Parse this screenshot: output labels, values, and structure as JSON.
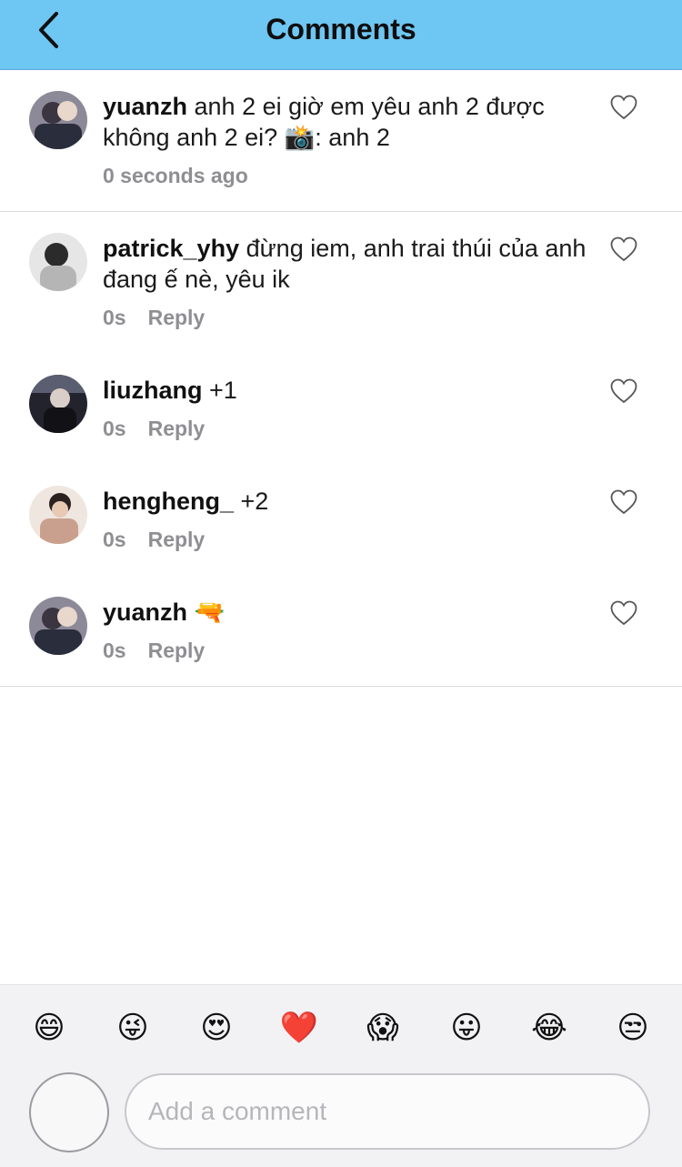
{
  "header": {
    "title": "Comments"
  },
  "icons": {
    "back": "chevron-left-icon",
    "like": "heart-outline-icon"
  },
  "comments": [
    {
      "username": "yuanzh",
      "text": " anh 2 ei giờ em yêu anh 2 được không anh 2 ei? 📸: anh 2",
      "time": "0 seconds ago",
      "reply": ""
    },
    {
      "username": "patrick_yhy",
      "text": " đừng iem, anh trai thúi của anh đang ế nè, yêu ik",
      "time": "0s",
      "reply": "Reply"
    },
    {
      "username": "liuzhang",
      "text": " +1",
      "time": "0s",
      "reply": "Reply"
    },
    {
      "username": "hengheng_",
      "text": " +2",
      "time": "0s",
      "reply": "Reply"
    },
    {
      "username": "yuanzh",
      "text": " 🔫",
      "time": "0s",
      "reply": "Reply"
    }
  ],
  "emoji_bar": [
    "😄",
    "😜",
    "😍",
    "❤️",
    "😱",
    "😛",
    "😂",
    "😒"
  ],
  "composer": {
    "placeholder": "Add a comment"
  }
}
